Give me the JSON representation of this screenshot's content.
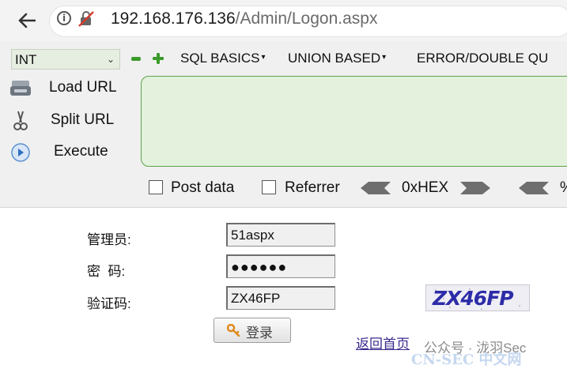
{
  "browser": {
    "url_host": "192.168.176.136",
    "url_path": "/Admin/Logon.aspx"
  },
  "hackbar": {
    "select_value": "INT",
    "menu": [
      "SQL BASICS",
      "UNION BASED",
      "ERROR/DOUBLE QU"
    ],
    "load_url": "Load URL",
    "split_url": "Split URL",
    "execute": "Execute",
    "post_data": "Post data",
    "referrer": "Referrer",
    "hex_label": "0xHEX",
    "more_label": "%"
  },
  "login": {
    "admin_label": "管理员:",
    "password_label": "密  码:",
    "captcha_label": "验证码:",
    "username_value": "51aspx",
    "password_value": "●●●●●●",
    "captcha_value": "ZX46FP",
    "captcha_image_text": "ZX46FP",
    "login_button": "登录",
    "back_home": "返回首页"
  },
  "watermark": {
    "line1": "公众号 · 泷羽Sec",
    "line2": "CN-SEC 中文网"
  },
  "colors": {
    "accent_green": "#5ea34a",
    "url_area_bg": "#e3f1dd",
    "link": "#3a2b8e"
  }
}
